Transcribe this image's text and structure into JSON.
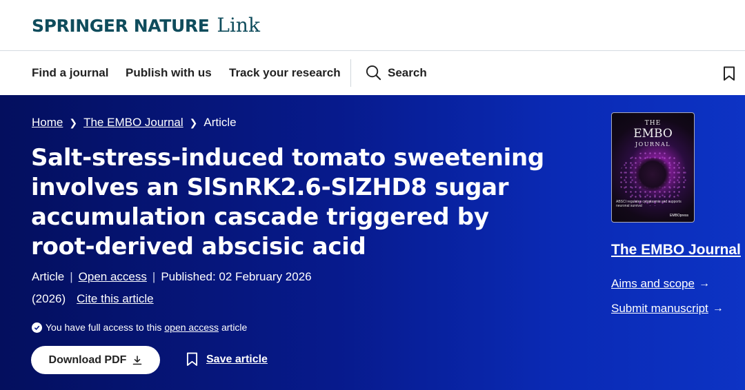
{
  "header": {
    "brand": "SPRINGER NATURE",
    "brand_suffix": "Link"
  },
  "nav": {
    "find_journal": "Find a journal",
    "publish": "Publish with us",
    "track": "Track your research",
    "search": "Search"
  },
  "breadcrumb": {
    "home": "Home",
    "journal": "The EMBO Journal",
    "current": "Article"
  },
  "article": {
    "title": "Salt-stress-induced tomato sweetening involves an SlSnRK2.6-SlZHD8 sugar accumulation cascade triggered by root-derived abscisic acid",
    "type": "Article",
    "open_access": "Open access",
    "published": "Published: 02 February 2026",
    "year": "(2026)",
    "cite": "Cite this article",
    "access_prefix": "You have full access to this",
    "access_link": "open access",
    "access_suffix": "article",
    "download": "Download PDF",
    "save": "Save article"
  },
  "sidebar": {
    "cover_the": "THE",
    "cover_embo": "EMBO",
    "cover_journal": "JOURNAL",
    "cover_caption": "ABSCI regulates cytoplasmic and supports neuronal survival",
    "cover_brand": "EMBOpress",
    "journal_title": "The EMBO Journal",
    "aims": "Aims and scope",
    "submit": "Submit manuscript"
  },
  "colors": {
    "brand": "#0f4c5c",
    "hero_start": "#040f5e",
    "hero_end": "#0d33c4"
  }
}
